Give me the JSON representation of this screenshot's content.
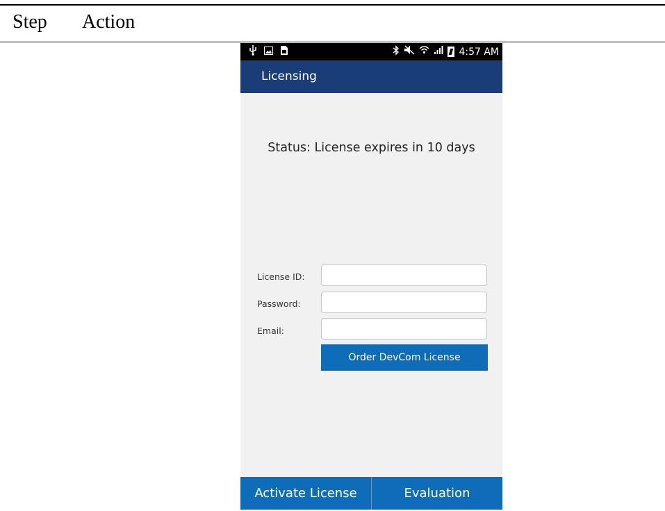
{
  "doc": {
    "col_step": "Step",
    "col_action": "Action"
  },
  "status_bar": {
    "time": "4:57 AM",
    "left_icons": [
      "usb-icon",
      "image-icon",
      "sim-icon"
    ],
    "right_icons": [
      "bluetooth-icon",
      "mute-icon",
      "wifi-icon",
      "signal-icon",
      "battery-charging-icon"
    ]
  },
  "app": {
    "title": "Licensing",
    "status_text": "Status: License expires in 10 days",
    "form": {
      "license_id_label": "License ID:",
      "license_id_value": "",
      "password_label": "Password:",
      "password_value": "",
      "email_label": "Email:",
      "email_value": "",
      "order_button": "Order DevCom License"
    },
    "bottom": {
      "activate": "Activate License",
      "evaluation": "Evaluation"
    }
  },
  "colors": {
    "title_bar": "#1a3d78",
    "accent_blue": "#0f6cb8",
    "background": "#f1f1f1"
  }
}
